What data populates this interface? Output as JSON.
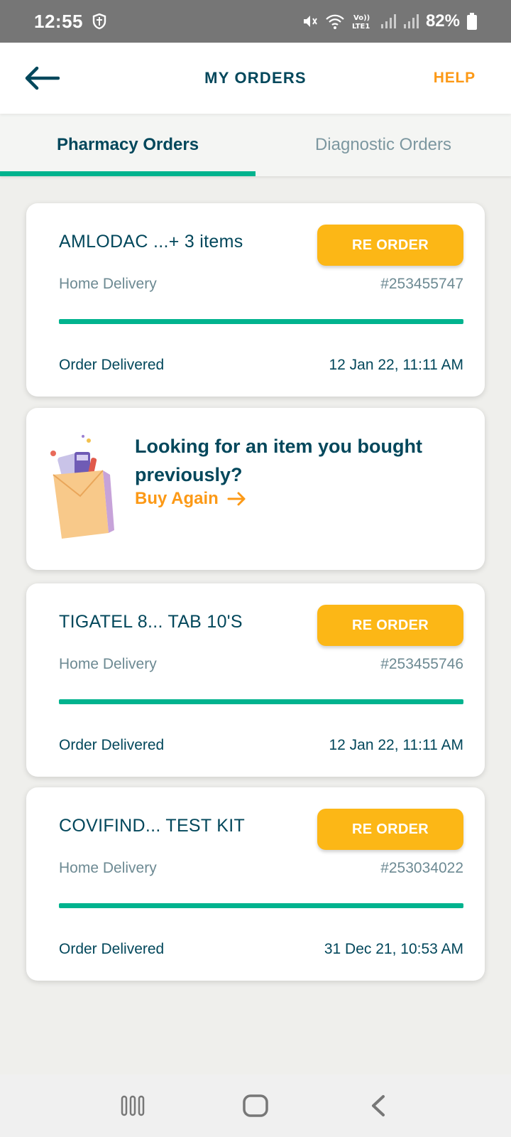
{
  "status_bar": {
    "time": "12:55",
    "battery": "82%",
    "icons": [
      "shield-icon",
      "mute-icon",
      "wifi-icon",
      "volte-icon",
      "signal-icon",
      "signal-icon",
      "battery-icon"
    ]
  },
  "header": {
    "title": "MY ORDERS",
    "help_label": "HELP",
    "back_icon": "back-arrow-icon"
  },
  "tabs": [
    {
      "label": "Pharmacy Orders",
      "active": true
    },
    {
      "label": "Diagnostic Orders",
      "active": false
    }
  ],
  "orders": [
    {
      "title": "AMLODAC ...+ 3 items",
      "reorder_label": "RE ORDER",
      "delivery_type": "Home Delivery",
      "order_id": "#253455747",
      "status": "Order Delivered",
      "date": "12 Jan 22, 11:11 AM"
    },
    {
      "title": "TIGATEL 8... TAB 10'S",
      "reorder_label": "RE ORDER",
      "delivery_type": "Home Delivery",
      "order_id": "#253455746",
      "status": "Order Delivered",
      "date": "12 Jan 22, 11:11 AM"
    },
    {
      "title": "COVIFIND... TEST KIT",
      "reorder_label": "RE ORDER",
      "delivery_type": "Home Delivery",
      "order_id": "#253034022",
      "status": "Order Delivered",
      "date": "31 Dec 21, 10:53 AM"
    }
  ],
  "promo": {
    "title": "Looking for an item you bought previously?",
    "link_label": "Buy Again",
    "illustration": "medicine-bag-icon"
  },
  "colors": {
    "brand_dark": "#02475b",
    "accent_orange": "#fc9916",
    "button_yellow": "#fcb716",
    "success_green": "#00b38e"
  },
  "nav_bar": {
    "icons": [
      "recent-apps-icon",
      "home-icon",
      "back-icon"
    ]
  }
}
